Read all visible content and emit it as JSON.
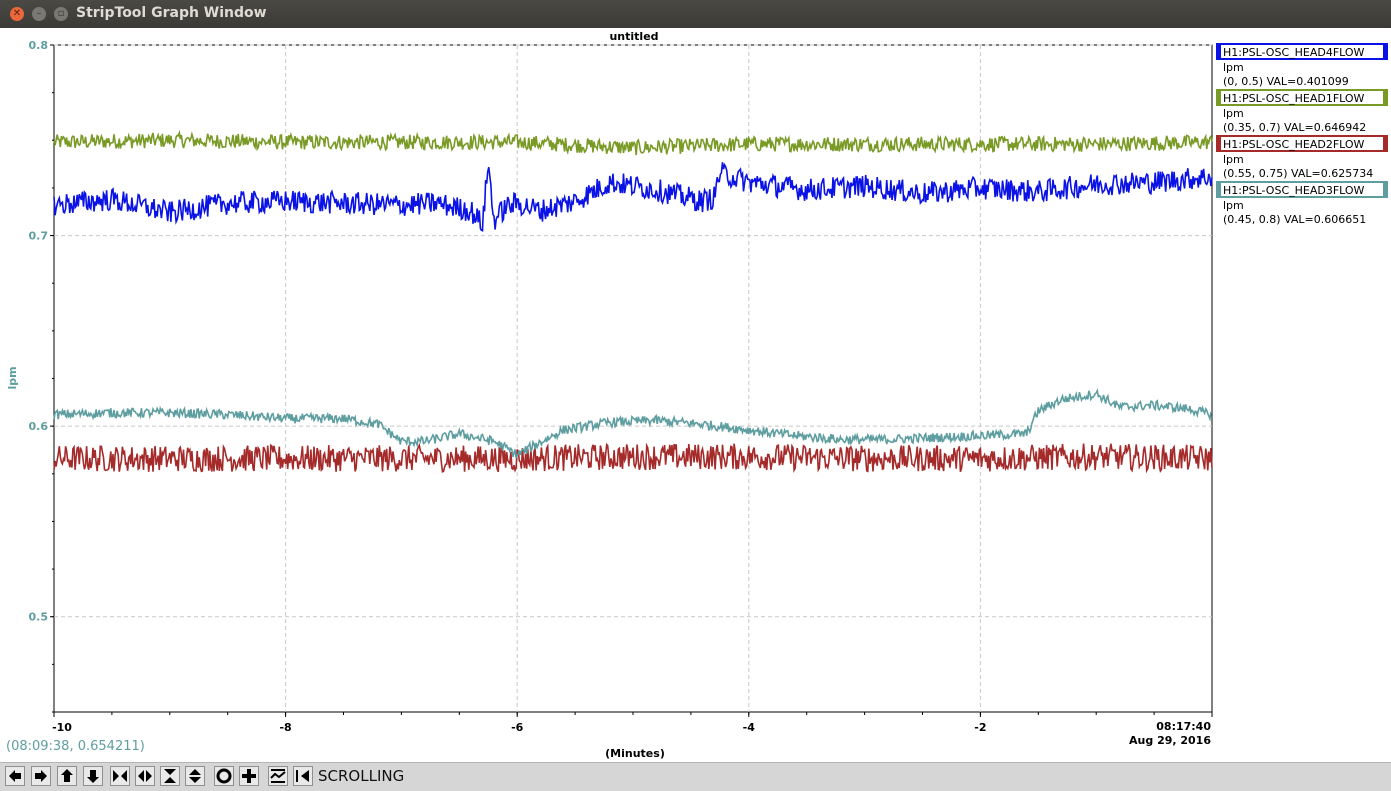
{
  "window": {
    "title": "StripTool Graph Window"
  },
  "plot": {
    "title": "untitled",
    "ylabel": "lpm",
    "xlabel": "(Minutes)",
    "cursor_readout": "(08:09:38, 0.654211)",
    "ytick_labels": [
      "0.8",
      "0.7",
      "0.6",
      "0.5"
    ],
    "xtick_labels": [
      "-10",
      "-8",
      "-6",
      "-4",
      "-2"
    ],
    "end_time": "08:17:40",
    "end_date": "Aug 29, 2016"
  },
  "legend": [
    {
      "name": "H1:PSL-OSC_HEAD4FLOW",
      "units": "lpm",
      "range_val": "(0, 0.5) VAL=0.401099",
      "color": "#0a12e6"
    },
    {
      "name": "H1:PSL-OSC_HEAD1FLOW",
      "units": "lpm",
      "range_val": "(0.35, 0.7) VAL=0.646942",
      "color": "#7a9a26"
    },
    {
      "name": "H1:PSL-OSC_HEAD2FLOW",
      "units": "lpm",
      "range_val": "(0.55, 0.75) VAL=0.625734",
      "color": "#a52a2a"
    },
    {
      "name": "H1:PSL-OSC_HEAD3FLOW",
      "units": "lpm",
      "range_val": "(0.45, 0.8) VAL=0.606651",
      "color": "#5f9ea0"
    }
  ],
  "toolbar": {
    "mode_label": "SCROLLING",
    "icons": [
      "scroll-left-icon",
      "scroll-right-icon",
      "scroll-up-icon",
      "scroll-down-icon",
      "zoom-in-x-icon",
      "zoom-out-x-icon",
      "zoom-in-y-icon",
      "zoom-out-y-icon",
      "reset-icon",
      "pan-icon",
      "auto-scale-icon",
      "refresh-icon"
    ]
  },
  "chart_data": {
    "type": "line",
    "title": "untitled",
    "xlabel": "(Minutes)",
    "ylabel": "lpm",
    "xlim": [
      -10,
      0
    ],
    "ylim": [
      0.45,
      0.8
    ],
    "grid": true,
    "legend_position": "right",
    "series": [
      {
        "name": "H1:PSL-OSC_HEAD4FLOW",
        "color": "#0a12e6",
        "x": [
          -10,
          -9.5,
          -9,
          -8.5,
          -8,
          -7.5,
          -7,
          -6.7,
          -6.4,
          -6.3,
          -6.25,
          -6.2,
          -6.1,
          -6.0,
          -5.8,
          -5.5,
          -5.2,
          -4.8,
          -4.4,
          -4.3,
          -4.25,
          -4.0,
          -3.5,
          -3.0,
          -2.5,
          -2.0,
          -1.5,
          -1.0,
          -0.5,
          0
        ],
        "y": [
          0.716,
          0.719,
          0.712,
          0.717,
          0.718,
          0.717,
          0.716,
          0.717,
          0.713,
          0.706,
          0.738,
          0.708,
          0.715,
          0.717,
          0.713,
          0.718,
          0.728,
          0.724,
          0.718,
          0.72,
          0.733,
          0.728,
          0.724,
          0.726,
          0.722,
          0.725,
          0.723,
          0.727,
          0.728,
          0.731
        ],
        "noise": 0.006
      },
      {
        "name": "H1:PSL-OSC_HEAD1FLOW",
        "color": "#7a9a26",
        "x": [
          -10,
          -9,
          -8,
          -7,
          -6,
          -5,
          -4,
          -3,
          -2,
          -1,
          0
        ],
        "y": [
          0.749,
          0.75,
          0.749,
          0.749,
          0.749,
          0.746,
          0.748,
          0.748,
          0.748,
          0.748,
          0.749
        ],
        "noise": 0.004
      },
      {
        "name": "H1:PSL-OSC_HEAD2FLOW",
        "color": "#a52a2a",
        "x": [
          -10,
          -9,
          -8,
          -7,
          -6,
          -5,
          -4,
          -3,
          -2,
          -1,
          0
        ],
        "y": [
          0.583,
          0.583,
          0.583,
          0.583,
          0.583,
          0.584,
          0.584,
          0.583,
          0.583,
          0.584,
          0.583
        ],
        "noise": 0.007
      },
      {
        "name": "H1:PSL-OSC_HEAD3FLOW",
        "color": "#5f9ea0",
        "x": [
          -10,
          -9.5,
          -9,
          -8.5,
          -8,
          -7.5,
          -7.2,
          -7.0,
          -6.8,
          -6.5,
          -6.2,
          -6.0,
          -5.6,
          -5.2,
          -4.8,
          -4.4,
          -4.0,
          -3.6,
          -3.2,
          -2.8,
          -2.4,
          -2.0,
          -1.6,
          -1.5,
          -1.3,
          -1.0,
          -0.8,
          -0.5,
          -0.2,
          0
        ],
        "y": [
          0.606,
          0.607,
          0.607,
          0.606,
          0.604,
          0.604,
          0.601,
          0.592,
          0.592,
          0.596,
          0.592,
          0.585,
          0.598,
          0.602,
          0.603,
          0.601,
          0.598,
          0.595,
          0.593,
          0.593,
          0.594,
          0.595,
          0.596,
          0.608,
          0.614,
          0.617,
          0.61,
          0.611,
          0.609,
          0.606
        ],
        "noise": 0.0025
      }
    ]
  }
}
